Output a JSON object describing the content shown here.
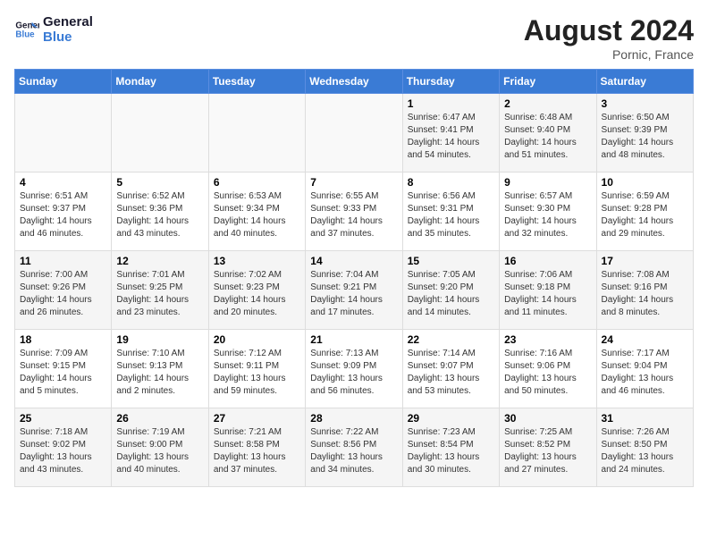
{
  "header": {
    "logo_line1": "General",
    "logo_line2": "Blue",
    "month_year": "August 2024",
    "location": "Pornic, France"
  },
  "days_of_week": [
    "Sunday",
    "Monday",
    "Tuesday",
    "Wednesday",
    "Thursday",
    "Friday",
    "Saturday"
  ],
  "weeks": [
    [
      {
        "day": "",
        "info": ""
      },
      {
        "day": "",
        "info": ""
      },
      {
        "day": "",
        "info": ""
      },
      {
        "day": "",
        "info": ""
      },
      {
        "day": "1",
        "info": "Sunrise: 6:47 AM\nSunset: 9:41 PM\nDaylight: 14 hours\nand 54 minutes."
      },
      {
        "day": "2",
        "info": "Sunrise: 6:48 AM\nSunset: 9:40 PM\nDaylight: 14 hours\nand 51 minutes."
      },
      {
        "day": "3",
        "info": "Sunrise: 6:50 AM\nSunset: 9:39 PM\nDaylight: 14 hours\nand 48 minutes."
      }
    ],
    [
      {
        "day": "4",
        "info": "Sunrise: 6:51 AM\nSunset: 9:37 PM\nDaylight: 14 hours\nand 46 minutes."
      },
      {
        "day": "5",
        "info": "Sunrise: 6:52 AM\nSunset: 9:36 PM\nDaylight: 14 hours\nand 43 minutes."
      },
      {
        "day": "6",
        "info": "Sunrise: 6:53 AM\nSunset: 9:34 PM\nDaylight: 14 hours\nand 40 minutes."
      },
      {
        "day": "7",
        "info": "Sunrise: 6:55 AM\nSunset: 9:33 PM\nDaylight: 14 hours\nand 37 minutes."
      },
      {
        "day": "8",
        "info": "Sunrise: 6:56 AM\nSunset: 9:31 PM\nDaylight: 14 hours\nand 35 minutes."
      },
      {
        "day": "9",
        "info": "Sunrise: 6:57 AM\nSunset: 9:30 PM\nDaylight: 14 hours\nand 32 minutes."
      },
      {
        "day": "10",
        "info": "Sunrise: 6:59 AM\nSunset: 9:28 PM\nDaylight: 14 hours\nand 29 minutes."
      }
    ],
    [
      {
        "day": "11",
        "info": "Sunrise: 7:00 AM\nSunset: 9:26 PM\nDaylight: 14 hours\nand 26 minutes."
      },
      {
        "day": "12",
        "info": "Sunrise: 7:01 AM\nSunset: 9:25 PM\nDaylight: 14 hours\nand 23 minutes."
      },
      {
        "day": "13",
        "info": "Sunrise: 7:02 AM\nSunset: 9:23 PM\nDaylight: 14 hours\nand 20 minutes."
      },
      {
        "day": "14",
        "info": "Sunrise: 7:04 AM\nSunset: 9:21 PM\nDaylight: 14 hours\nand 17 minutes."
      },
      {
        "day": "15",
        "info": "Sunrise: 7:05 AM\nSunset: 9:20 PM\nDaylight: 14 hours\nand 14 minutes."
      },
      {
        "day": "16",
        "info": "Sunrise: 7:06 AM\nSunset: 9:18 PM\nDaylight: 14 hours\nand 11 minutes."
      },
      {
        "day": "17",
        "info": "Sunrise: 7:08 AM\nSunset: 9:16 PM\nDaylight: 14 hours\nand 8 minutes."
      }
    ],
    [
      {
        "day": "18",
        "info": "Sunrise: 7:09 AM\nSunset: 9:15 PM\nDaylight: 14 hours\nand 5 minutes."
      },
      {
        "day": "19",
        "info": "Sunrise: 7:10 AM\nSunset: 9:13 PM\nDaylight: 14 hours\nand 2 minutes."
      },
      {
        "day": "20",
        "info": "Sunrise: 7:12 AM\nSunset: 9:11 PM\nDaylight: 13 hours\nand 59 minutes."
      },
      {
        "day": "21",
        "info": "Sunrise: 7:13 AM\nSunset: 9:09 PM\nDaylight: 13 hours\nand 56 minutes."
      },
      {
        "day": "22",
        "info": "Sunrise: 7:14 AM\nSunset: 9:07 PM\nDaylight: 13 hours\nand 53 minutes."
      },
      {
        "day": "23",
        "info": "Sunrise: 7:16 AM\nSunset: 9:06 PM\nDaylight: 13 hours\nand 50 minutes."
      },
      {
        "day": "24",
        "info": "Sunrise: 7:17 AM\nSunset: 9:04 PM\nDaylight: 13 hours\nand 46 minutes."
      }
    ],
    [
      {
        "day": "25",
        "info": "Sunrise: 7:18 AM\nSunset: 9:02 PM\nDaylight: 13 hours\nand 43 minutes."
      },
      {
        "day": "26",
        "info": "Sunrise: 7:19 AM\nSunset: 9:00 PM\nDaylight: 13 hours\nand 40 minutes."
      },
      {
        "day": "27",
        "info": "Sunrise: 7:21 AM\nSunset: 8:58 PM\nDaylight: 13 hours\nand 37 minutes."
      },
      {
        "day": "28",
        "info": "Sunrise: 7:22 AM\nSunset: 8:56 PM\nDaylight: 13 hours\nand 34 minutes."
      },
      {
        "day": "29",
        "info": "Sunrise: 7:23 AM\nSunset: 8:54 PM\nDaylight: 13 hours\nand 30 minutes."
      },
      {
        "day": "30",
        "info": "Sunrise: 7:25 AM\nSunset: 8:52 PM\nDaylight: 13 hours\nand 27 minutes."
      },
      {
        "day": "31",
        "info": "Sunrise: 7:26 AM\nSunset: 8:50 PM\nDaylight: 13 hours\nand 24 minutes."
      }
    ]
  ]
}
